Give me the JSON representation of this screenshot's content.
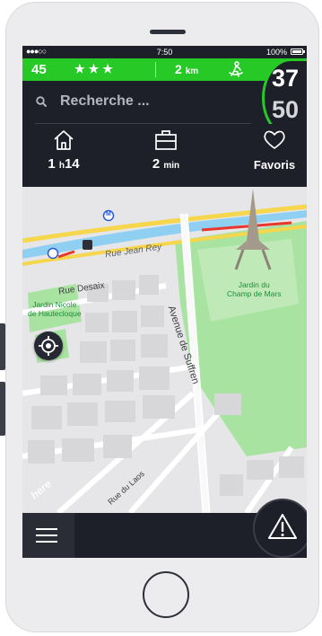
{
  "status_bar": {
    "signal": "●●●○○",
    "time": "7:50",
    "battery": "100%"
  },
  "info_bar": {
    "count": "45",
    "stars": "★★★",
    "distance": "2",
    "distance_unit": "km"
  },
  "search": {
    "placeholder": "Recherche ..."
  },
  "speed": {
    "current": "37",
    "limit": "50"
  },
  "shortcuts": {
    "home_hours": "1",
    "home_h": "h",
    "home_minutes": "14",
    "work_value": "2",
    "work_unit": "min",
    "favorites_label": "Favoris"
  },
  "map": {
    "labels": {
      "rue_jean_rey": "Rue Jean Rey",
      "rue_desaix": "Rue Desaix",
      "jardin_nicole_1": "Jardin Nicole",
      "jardin_nicole_2": "de Hautecloque",
      "jardin_champ_1": "Jardin du",
      "jardin_champ_2": "Champ de Mars",
      "avenue_suffren": "Avenue de Suffren",
      "rue_laos": "Rue du Laos",
      "watermark": "here"
    },
    "metro_symbol": "M"
  },
  "colors": {
    "accent_green": "#26c926",
    "panel": "#1d1f29",
    "park": "#a9e3a1",
    "river": "#8fd0f2",
    "road_yellow": "#f5d64c"
  },
  "icons": {
    "search": "search-icon",
    "home": "home-icon",
    "work": "briefcase-icon",
    "favorites": "heart-icon",
    "locate": "crosshair-icon",
    "menu": "hamburger-icon",
    "alert": "warning-triangle-icon",
    "walker": "pedestrian-icon"
  }
}
